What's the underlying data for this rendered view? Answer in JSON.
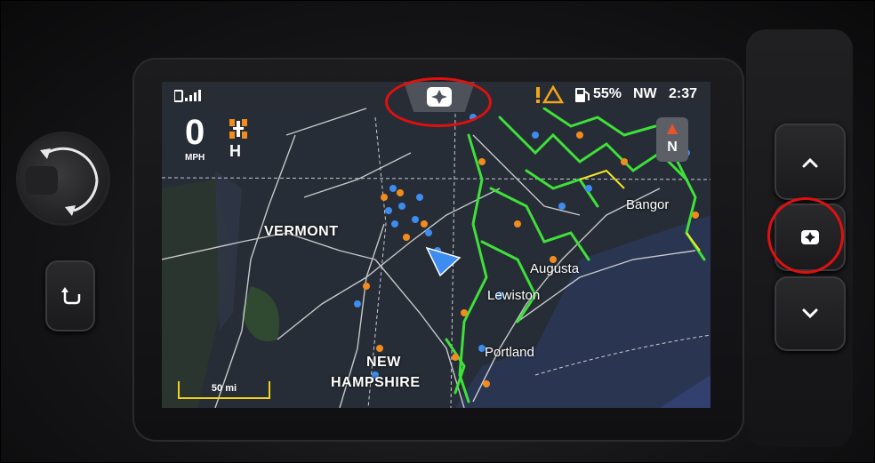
{
  "status_bar": {
    "signal_icon": "cellular-signal-icon",
    "warning_icon": "warning-triangle-icon",
    "fuel_icon": "fuel-pump-icon",
    "fuel_level": "55%",
    "heading": "NW",
    "time": "2:37",
    "menu_icon": "polaris-star-icon"
  },
  "dashboard": {
    "speed_value": "0",
    "speed_unit": "MPH",
    "drive_icon": "awd-drive-icon",
    "gear": "H"
  },
  "compass": {
    "label": "N",
    "icon": "north-arrow-icon"
  },
  "map": {
    "region_labels": [
      "VERMONT",
      "NEW",
      "HAMPSHIRE"
    ],
    "cities": [
      "Bangor",
      "Augusta",
      "Lewiston",
      "Portland"
    ],
    "scale_label": "50 mi",
    "position_icon": "navigation-arrow-icon"
  },
  "hardware_controls": {
    "rotary_knob": "rotary-knob-icon",
    "back_button": "back-arrow-icon",
    "up_button": "chevron-up-icon",
    "menu_button": "polaris-star-icon",
    "down_button": "chevron-down-icon"
  },
  "colors": {
    "trail_green": "#3fe03a",
    "trail_blue": "#3d8cf0",
    "trail_orange": "#f28c1c",
    "trail_yellow": "#f4e628",
    "highlight_red": "#e01010",
    "scale_yellow": "#f2d21b"
  }
}
